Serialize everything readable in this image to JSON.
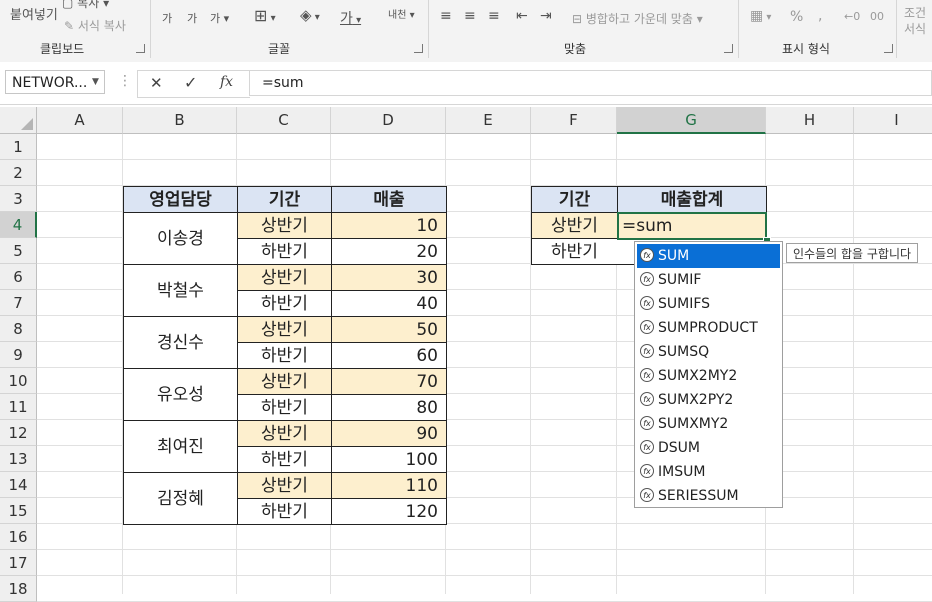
{
  "ribbon": {
    "clipboard": {
      "paste": "붙여넣기",
      "copy": "복사",
      "format_painter": "서식 복사",
      "label": "클립보드"
    },
    "font": {
      "label": "글꼴",
      "font_grow": "가",
      "font_shrink": "가",
      "phonetic": "가",
      "border_icon": "⊞",
      "fill_icon": "◈",
      "font_color": "가",
      "phonetic_guide": "내천"
    },
    "alignment": {
      "label": "맞춤",
      "merge_center": "병합하고 가운데 맞춤"
    },
    "number": {
      "label": "표시 형식",
      "percent": "%",
      "comma": ",",
      "dec_increase": "←0",
      "dec_decrease": "00"
    },
    "styles": {
      "conditional": "조건",
      "format": "서식"
    }
  },
  "formula_bar": {
    "name_box": "NETWOR...",
    "cancel": "✕",
    "enter": "✓",
    "fx": "fx",
    "content": "=sum"
  },
  "columns": [
    "A",
    "B",
    "C",
    "D",
    "E",
    "F",
    "G",
    "H",
    "I"
  ],
  "rows": [
    "1",
    "2",
    "3",
    "4",
    "5",
    "6",
    "7",
    "8",
    "9",
    "10",
    "11",
    "12",
    "13",
    "14",
    "15",
    "16",
    "17",
    "18"
  ],
  "table1": {
    "headers": [
      "영업담당",
      "기간",
      "매출"
    ],
    "people": [
      "이송경",
      "박철수",
      "경신수",
      "유오성",
      "최여진",
      "김정혜"
    ],
    "periods": [
      "상반기",
      "하반기"
    ],
    "sales": [
      [
        10,
        20
      ],
      [
        30,
        40
      ],
      [
        50,
        60
      ],
      [
        70,
        80
      ],
      [
        90,
        100
      ],
      [
        110,
        120
      ]
    ]
  },
  "table2": {
    "headers": [
      "기간",
      "매출합계"
    ],
    "periods": [
      "상반기",
      "하반기"
    ],
    "active_cell_text": "=sum"
  },
  "autocomplete": {
    "items": [
      "SUM",
      "SUMIF",
      "SUMIFS",
      "SUMPRODUCT",
      "SUMSQ",
      "SUMX2MY2",
      "SUMX2PY2",
      "SUMXMY2",
      "DSUM",
      "IMSUM",
      "SERIESSUM"
    ],
    "selected_index": 0,
    "tooltip": "인수들의 합을 구합니다"
  },
  "colors": {
    "header_fill": "#dbe4f3",
    "period_fill": "#fdefce",
    "select_green": "#217346",
    "ac_highlight": "#0a6fd6"
  }
}
